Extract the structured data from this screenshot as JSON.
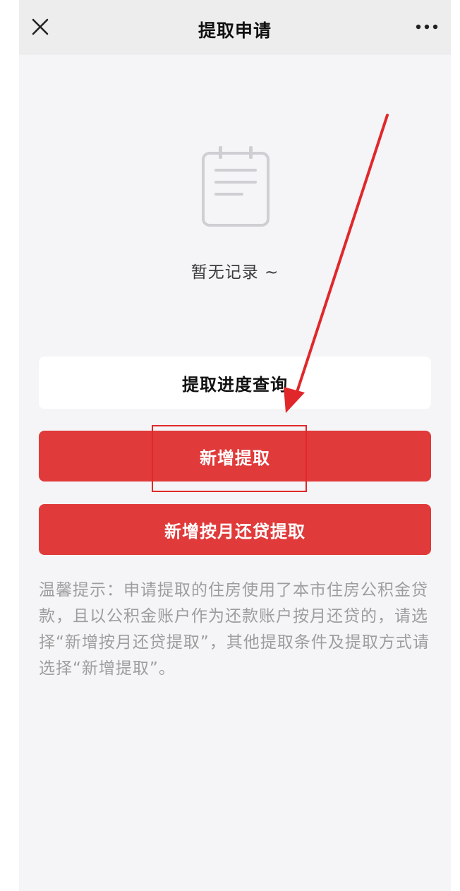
{
  "header": {
    "title": "提取申请",
    "close_icon": "close-icon",
    "more_icon": "more-dots-icon"
  },
  "empty_state": {
    "icon": "notepad-icon",
    "text": "暂无记录 ~"
  },
  "buttons": {
    "query_progress": "提取进度查询",
    "new_withdrawal": "新增提取",
    "new_monthly_loan_withdrawal": "新增按月还贷提取"
  },
  "tip": {
    "text": "温馨提示：申请提取的住房使用了本市住房公积金贷款，且以公积金账户作为还款账户按月还贷的，请选择“新增按月还贷提取”，其他提取条件及提取方式请选择“新增提取”。"
  },
  "colors": {
    "primary_red": "#e03a3a",
    "annotation_red": "#e0282b",
    "background": "#f5f5f7"
  }
}
